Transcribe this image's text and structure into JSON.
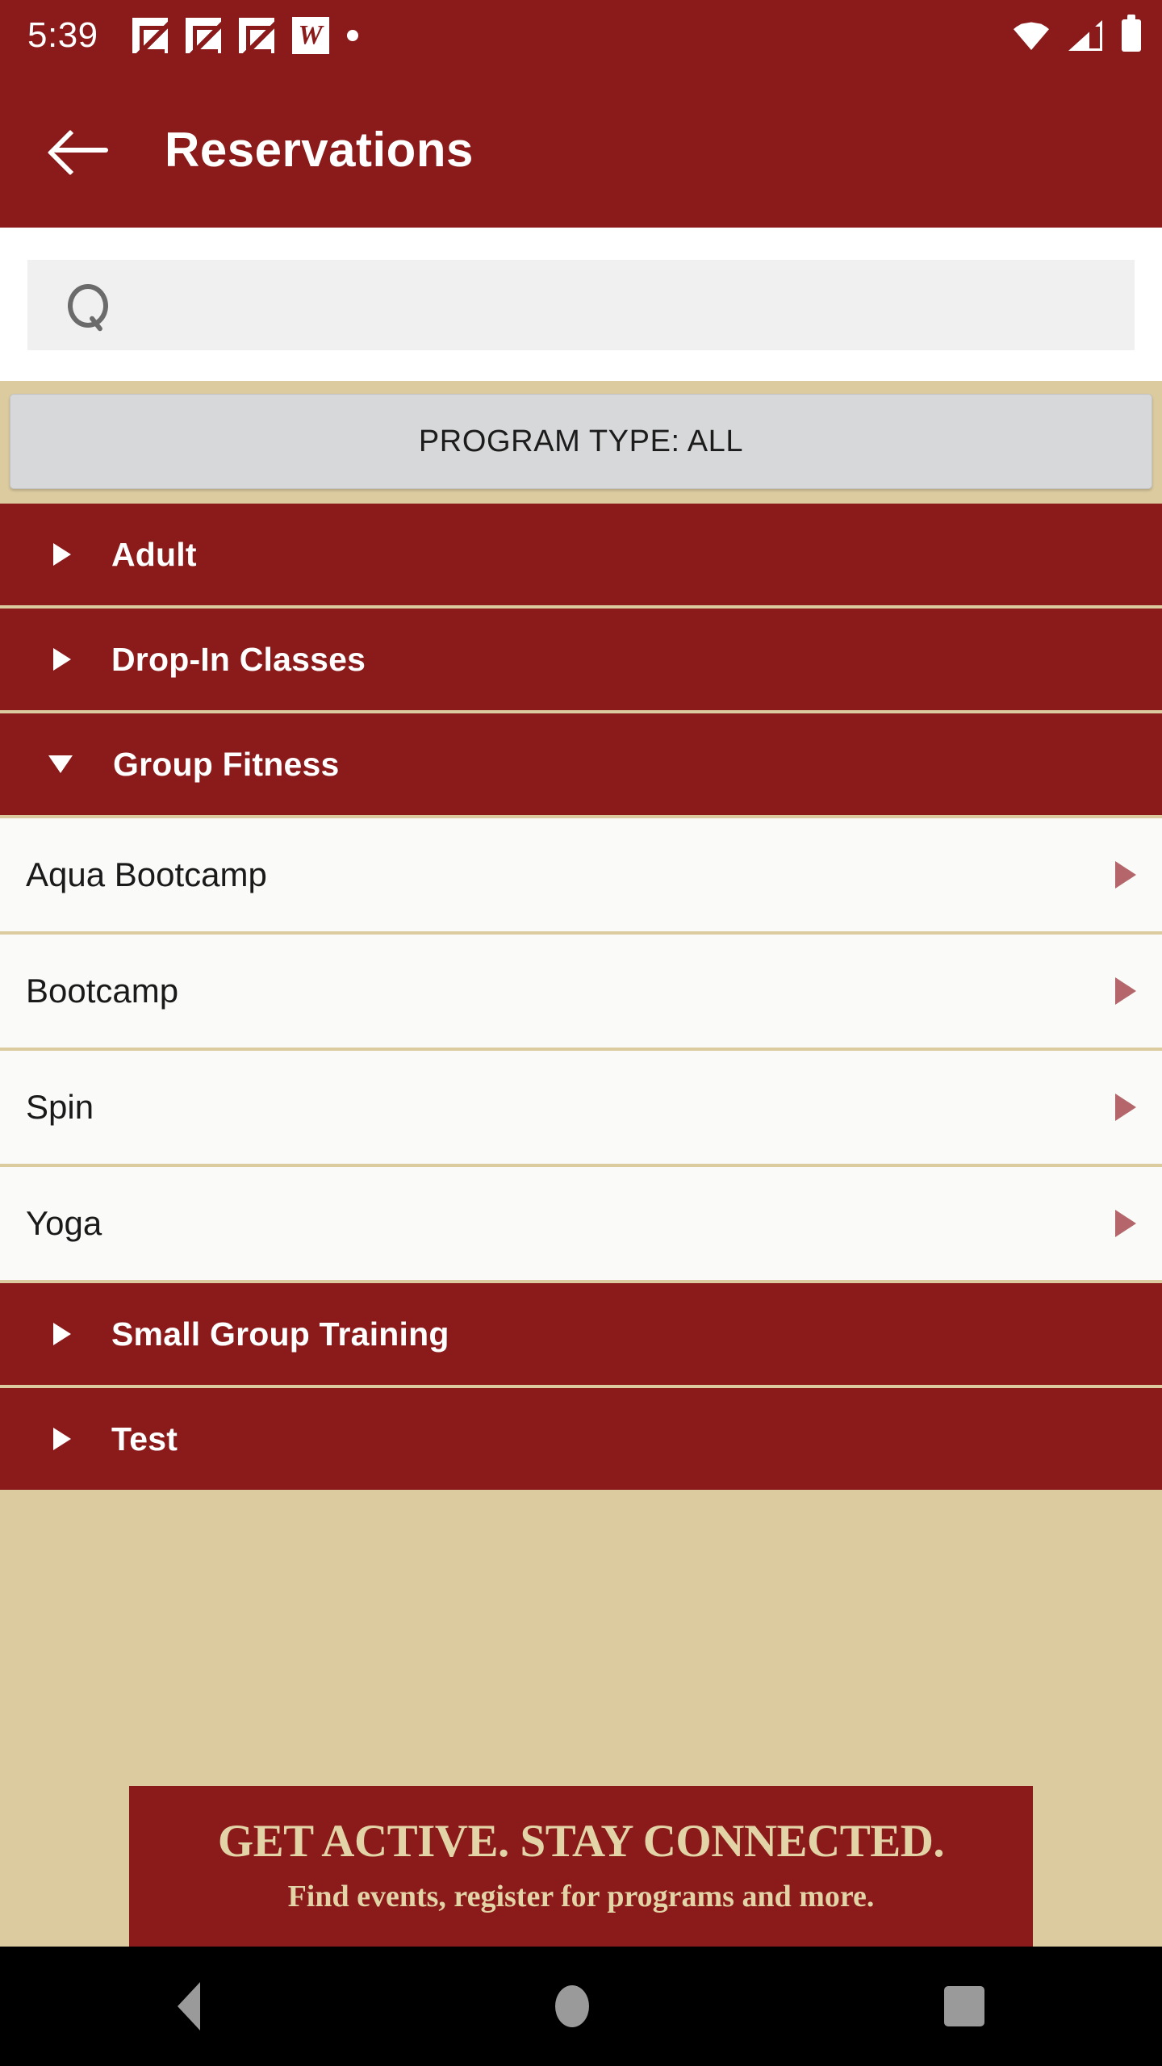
{
  "status_bar": {
    "time": "5:39",
    "notification_icons": [
      "app-notification-icon",
      "app-notification-icon",
      "app-notification-icon"
    ],
    "brand_icon_letter": "W",
    "overflow_dot": "more-notifications-dot",
    "right_icons": [
      "wifi-icon",
      "cellular-signal-icon",
      "battery-icon"
    ]
  },
  "app_bar": {
    "back_label": "back-arrow-icon",
    "title": "Reservations"
  },
  "search": {
    "value": "",
    "placeholder": "",
    "icon": "search-icon"
  },
  "filter": {
    "label": "PROGRAM TYPE: ALL"
  },
  "accordion": {
    "groups": [
      {
        "label": "Adult",
        "expanded": false,
        "caret": "caret-right-icon",
        "items": []
      },
      {
        "label": "Drop-In Classes",
        "expanded": false,
        "caret": "caret-right-icon",
        "items": []
      },
      {
        "label": "Group Fitness",
        "expanded": true,
        "caret": "caret-down-icon",
        "items": [
          {
            "label": "Aqua Bootcamp",
            "arrow": "chevron-right-icon"
          },
          {
            "label": "Bootcamp",
            "arrow": "chevron-right-icon"
          },
          {
            "label": "Spin",
            "arrow": "chevron-right-icon"
          },
          {
            "label": "Yoga",
            "arrow": "chevron-right-icon"
          }
        ]
      },
      {
        "label": "Small Group Training",
        "expanded": false,
        "caret": "caret-right-icon",
        "items": []
      },
      {
        "label": "Test",
        "expanded": false,
        "caret": "caret-right-icon",
        "items": []
      }
    ]
  },
  "banner": {
    "title": "GET ACTIVE.  STAY CONNECTED.",
    "subtitle": "Find events, register for programs and more."
  },
  "nav_bar": {
    "back": "navigation-back-icon",
    "home": "navigation-home-icon",
    "recents": "navigation-recents-icon"
  },
  "colors": {
    "brand_maroon": "#8B1A1A",
    "tan_background": "#DCCB9F",
    "item_background": "#FAFAF8",
    "filter_grey": "#D7D8D9",
    "arrow_rose": "#B5666B",
    "banner_text": "#E3D4A8"
  }
}
